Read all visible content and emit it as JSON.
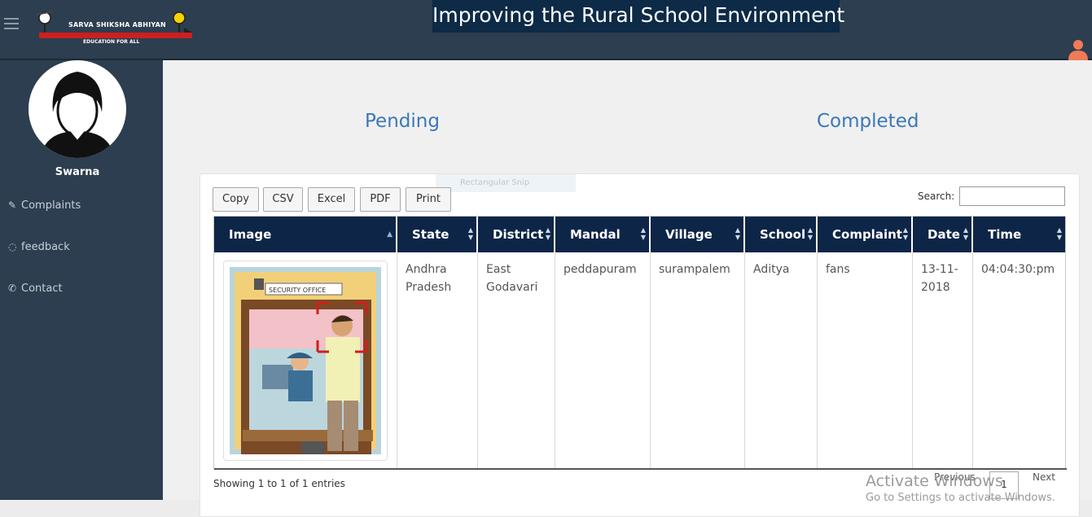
{
  "header": {
    "logo_text": "SARVA SHIKSHA ABHIYAN",
    "logo_subtext": "EDUCATION FOR ALL",
    "banner_title": "Improving  the  Rural  School Environment"
  },
  "sidebar": {
    "username": "Swarna",
    "items": [
      {
        "label": "Complaints",
        "icon": "edit-icon"
      },
      {
        "label": "feedback",
        "icon": "comment-icon"
      },
      {
        "label": "Contact",
        "icon": "phone-icon"
      }
    ]
  },
  "main": {
    "tabs": [
      {
        "label": "Pending"
      },
      {
        "label": "Completed"
      }
    ],
    "snip_label": "Rectangular Snip",
    "toolbar": {
      "buttons": [
        {
          "label": "Copy"
        },
        {
          "label": "CSV"
        },
        {
          "label": "Excel"
        },
        {
          "label": "PDF"
        },
        {
          "label": "Print"
        }
      ],
      "search_label": "Search:",
      "search_value": ""
    },
    "table": {
      "headers": [
        "Image",
        "State",
        "District",
        "Mandal",
        "Village",
        "School",
        "Complaint",
        "Date",
        "Time"
      ],
      "rows": [
        {
          "image_sign_text": "SECURITY OFFICE",
          "state": "Andhra Pradesh",
          "district": "East Godavari",
          "mandal": "peddapuram",
          "village": "surampalem",
          "school": "Aditya",
          "complaint": "fans",
          "date": "13-11-2018",
          "time": "04:04:30:pm"
        }
      ]
    },
    "footer": {
      "showing": "Showing 1 to 1 of 1 entries",
      "previous": "Previous",
      "page": "1",
      "next": "Next"
    }
  },
  "watermark": {
    "line1": "Activate Windows",
    "line2": "Go to Settings to activate Windows."
  },
  "colors": {
    "topbar": "#2c3e50",
    "banner": "#0d2a47",
    "table_header": "#0d2547",
    "tab_link": "#3a78b8",
    "user_icon": "#f07b55"
  }
}
